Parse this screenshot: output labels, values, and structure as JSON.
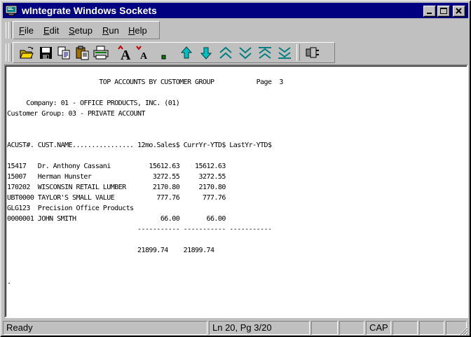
{
  "window": {
    "title": "wIntegrate Windows Sockets"
  },
  "menu": [
    {
      "label": "File",
      "mnemonic": "F",
      "rest": "ile"
    },
    {
      "label": "Edit",
      "mnemonic": "E",
      "rest": "dit"
    },
    {
      "label": "Setup",
      "mnemonic": "S",
      "rest": "etup"
    },
    {
      "label": "Run",
      "mnemonic": "R",
      "rest": "un"
    },
    {
      "label": "Help",
      "mnemonic": "H",
      "rest": "elp"
    }
  ],
  "toolbar": {
    "icons": [
      "open-folder-icon",
      "save-icon",
      "copy-icon",
      "paste-icon",
      "print-icon",
      "font-larger-icon",
      "font-smaller-icon",
      "small-font-icon",
      "scroll-up-icon",
      "scroll-down-icon",
      "page-up-icon",
      "page-down-icon",
      "top-icon",
      "bottom-icon",
      "connect-plug-icon"
    ]
  },
  "document": {
    "lines": [
      "                        TOP ACCOUNTS BY CUSTOMER GROUP           Page  3",
      "",
      "     Company: 01 - OFFICE PRODUCTS, INC. (01)",
      "Customer Group: 03 - PRIVATE ACCOUNT",
      "",
      "",
      "ACUST#. CUST.NAME................ 12mo.Sales$ CurrYr-YTD$ LastYr-YTD$",
      "",
      "15417   Dr. Anthony Cassani          15612.63    15612.63",
      "15007   Herman Hunster                3272.55     3272.55",
      "170202  WISCONSIN RETAIL LUMBER       2170.80     2170.80",
      "UBT0000 TAYLOR'S SMALL VALUE           777.76      777.76",
      "GLG123  Precision Office Products",
      "0000001 JOHN SMITH                      66.00       66.00",
      "                                  ----------- ----------- -----------",
      "",
      "                                  21899.74    21899.74",
      "",
      "",
      "."
    ]
  },
  "status": {
    "state": "Ready",
    "position": "Ln 20, Pg 3/20",
    "caps": "CAP"
  },
  "colors": {
    "titlebar": "#000080",
    "face": "#c0c0c0",
    "accent_arrows": "#00a0a0"
  }
}
